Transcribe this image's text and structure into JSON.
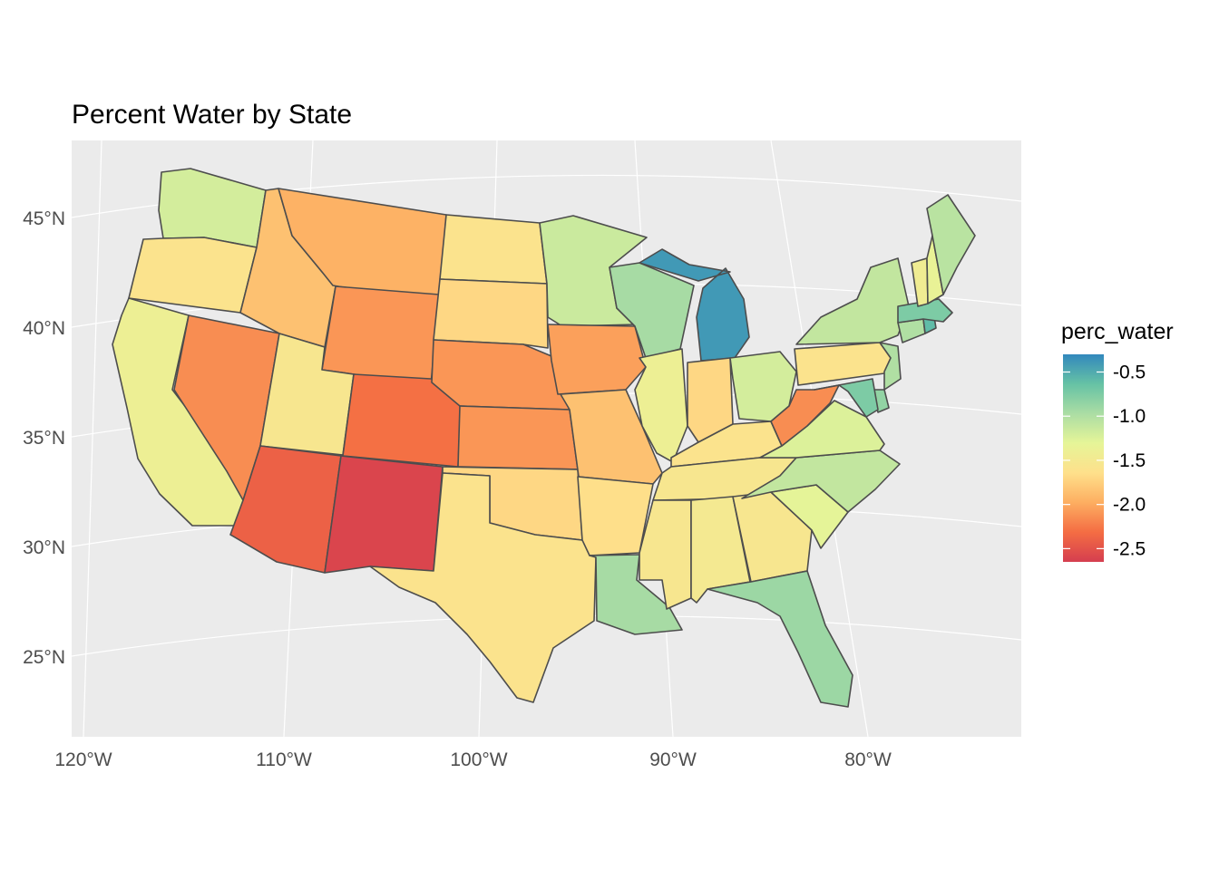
{
  "title": "Percent Water by State",
  "legend": {
    "title": "perc_water",
    "breaks": [
      -0.5,
      -1.0,
      -1.5,
      -2.0,
      -2.5
    ],
    "labels": [
      "-0.5",
      "-1.0",
      "-1.5",
      "-2.0",
      "-2.5"
    ],
    "range": [
      -2.65,
      -0.3
    ],
    "palette": [
      "#D53E4F",
      "#F46D43",
      "#FDAE61",
      "#FEE08B",
      "#E6F598",
      "#ABDDA4",
      "#66C2A5",
      "#3288BD"
    ]
  },
  "axes": {
    "y_labels": [
      "45°N",
      "40°N",
      "35°N",
      "30°N",
      "25°N"
    ],
    "x_labels": [
      "120°W",
      "110°W",
      "100°W",
      "90°W",
      "80°W"
    ]
  },
  "colors": {
    "panel": "#EBEBEB",
    "grid": "#FFFFFF",
    "border": "#4D4D4D"
  },
  "chart_data": {
    "type": "choropleth",
    "variable": "perc_water",
    "states": [
      {
        "name": "Washington",
        "value": -1.2
      },
      {
        "name": "Oregon",
        "value": -1.6
      },
      {
        "name": "California",
        "value": -1.4
      },
      {
        "name": "Nevada",
        "value": -2.15
      },
      {
        "name": "Idaho",
        "value": -1.85
      },
      {
        "name": "Montana",
        "value": -1.95
      },
      {
        "name": "Wyoming",
        "value": -2.1
      },
      {
        "name": "Utah",
        "value": -1.55
      },
      {
        "name": "Colorado",
        "value": -2.3
      },
      {
        "name": "Arizona",
        "value": -2.4
      },
      {
        "name": "New Mexico",
        "value": -2.6
      },
      {
        "name": "North Dakota",
        "value": -1.6
      },
      {
        "name": "South Dakota",
        "value": -1.7
      },
      {
        "name": "Nebraska",
        "value": -2.1
      },
      {
        "name": "Kansas",
        "value": -2.1
      },
      {
        "name": "Oklahoma",
        "value": -1.7
      },
      {
        "name": "Texas",
        "value": -1.6
      },
      {
        "name": "Minnesota",
        "value": -1.15
      },
      {
        "name": "Iowa",
        "value": -2.05
      },
      {
        "name": "Missouri",
        "value": -1.85
      },
      {
        "name": "Arkansas",
        "value": -1.65
      },
      {
        "name": "Louisiana",
        "value": -0.95
      },
      {
        "name": "Wisconsin",
        "value": -0.95
      },
      {
        "name": "Illinois",
        "value": -1.4
      },
      {
        "name": "Michigan",
        "value": -0.4
      },
      {
        "name": "Indiana",
        "value": -1.7
      },
      {
        "name": "Ohio",
        "value": -1.2
      },
      {
        "name": "Kentucky",
        "value": -1.6
      },
      {
        "name": "Tennessee",
        "value": -1.55
      },
      {
        "name": "Mississippi",
        "value": -1.55
      },
      {
        "name": "Alabama",
        "value": -1.5
      },
      {
        "name": "Georgia",
        "value": -1.55
      },
      {
        "name": "Florida",
        "value": -0.9
      },
      {
        "name": "South Carolina",
        "value": -1.3
      },
      {
        "name": "North Carolina",
        "value": -1.1
      },
      {
        "name": "Virginia",
        "value": -1.25
      },
      {
        "name": "West Virginia",
        "value": -2.15
      },
      {
        "name": "Pennsylvania",
        "value": -1.6
      },
      {
        "name": "New York",
        "value": -1.1
      },
      {
        "name": "Vermont",
        "value": -1.45
      },
      {
        "name": "New Hampshire",
        "value": -1.35
      },
      {
        "name": "Maine",
        "value": -1.05
      },
      {
        "name": "Massachusetts",
        "value": -0.75
      },
      {
        "name": "Rhode Island",
        "value": -0.6
      },
      {
        "name": "Connecticut",
        "value": -1.0
      },
      {
        "name": "New Jersey",
        "value": -1.0
      },
      {
        "name": "Delaware",
        "value": -0.85
      },
      {
        "name": "Maryland",
        "value": -0.75
      }
    ]
  }
}
